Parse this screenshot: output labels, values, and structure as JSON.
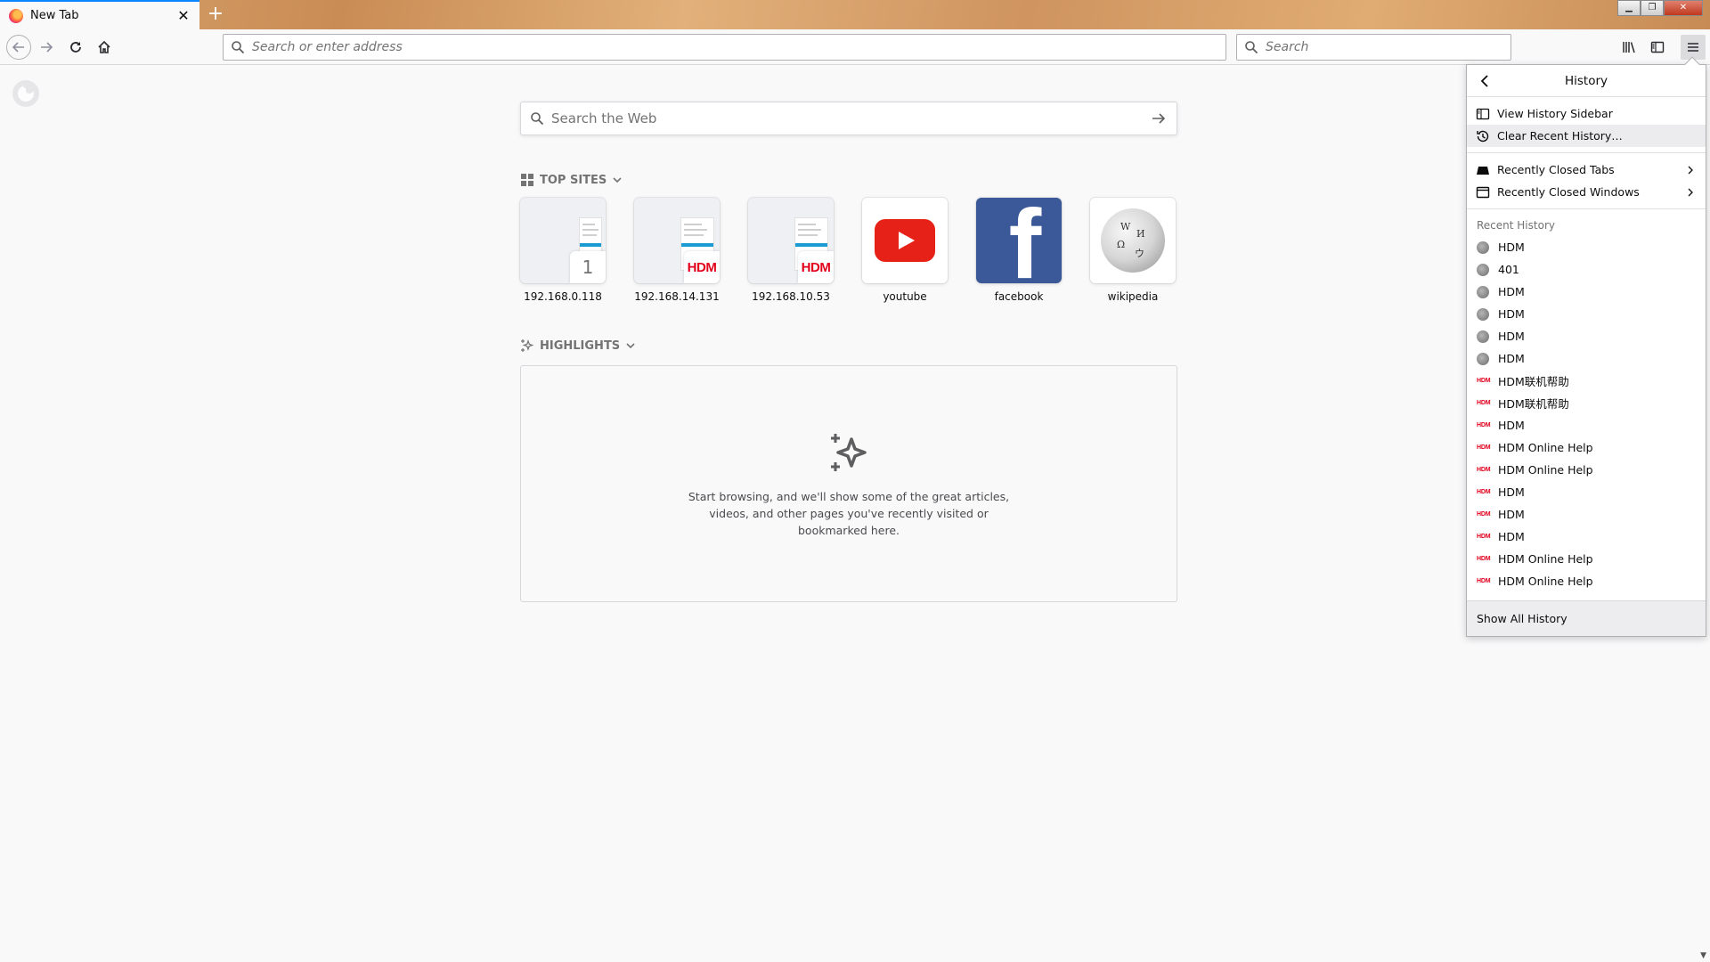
{
  "tab": {
    "title": "New Tab"
  },
  "toolbar": {
    "url_placeholder": "Search or enter address",
    "search_placeholder": "Search"
  },
  "newtab": {
    "web_search_placeholder": "Search the Web",
    "top_sites_label": "TOP SITES",
    "highlights_label": "HIGHLIGHTS",
    "highlights_empty": "Start browsing, and we'll show some of the great articles, videos, and other pages you've recently visited or bookmarked here.",
    "top_sites": [
      {
        "label": "192.168.0.118",
        "badge": "1"
      },
      {
        "label": "192.168.14.131",
        "badge": "HDM"
      },
      {
        "label": "192.168.10.53",
        "badge": "HDM"
      },
      {
        "label": "youtube"
      },
      {
        "label": "facebook"
      },
      {
        "label": "wikipedia"
      }
    ]
  },
  "history_panel": {
    "title": "History",
    "view_sidebar": "View History Sidebar",
    "clear_recent": "Clear Recent History…",
    "recently_closed_tabs": "Recently Closed Tabs",
    "recently_closed_windows": "Recently Closed Windows",
    "recent_history_label": "Recent History",
    "hdm_favicon_text": "HDM",
    "items": [
      {
        "label": "HDM",
        "icon": "globe"
      },
      {
        "label": "401",
        "icon": "globe"
      },
      {
        "label": "HDM",
        "icon": "globe"
      },
      {
        "label": "HDM",
        "icon": "globe"
      },
      {
        "label": "HDM",
        "icon": "globe"
      },
      {
        "label": "HDM",
        "icon": "globe"
      },
      {
        "label": "HDM联机帮助",
        "icon": "hdm"
      },
      {
        "label": "HDM联机帮助",
        "icon": "hdm"
      },
      {
        "label": "HDM",
        "icon": "hdm"
      },
      {
        "label": "HDM Online Help",
        "icon": "hdm"
      },
      {
        "label": "HDM Online Help",
        "icon": "hdm"
      },
      {
        "label": "HDM",
        "icon": "hdm"
      },
      {
        "label": "HDM",
        "icon": "hdm"
      },
      {
        "label": "HDM",
        "icon": "hdm"
      },
      {
        "label": "HDM Online Help",
        "icon": "hdm"
      },
      {
        "label": "HDM Online Help",
        "icon": "hdm"
      }
    ],
    "show_all": "Show All History"
  }
}
